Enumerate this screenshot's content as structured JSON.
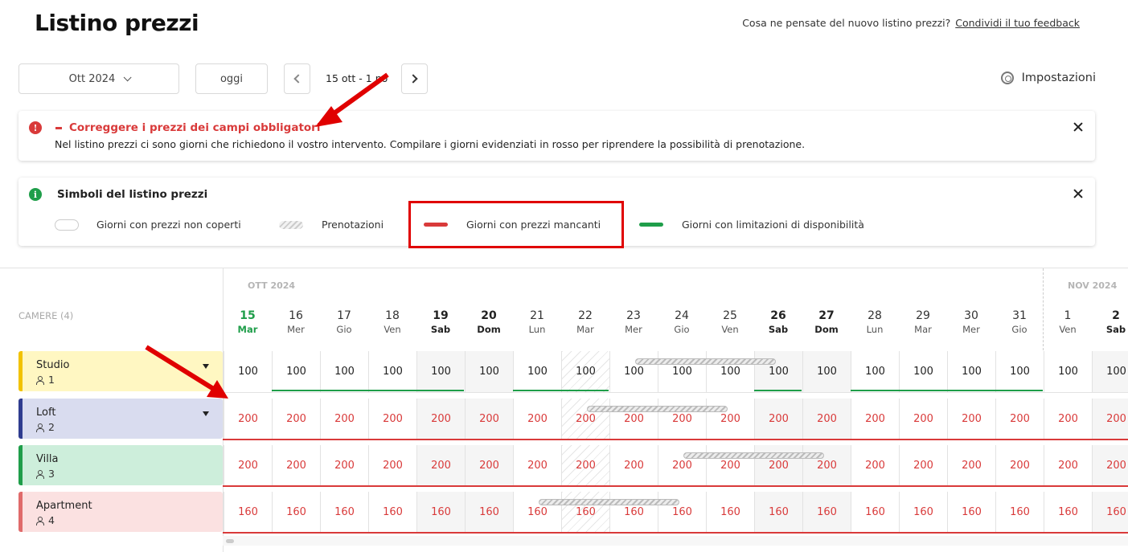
{
  "page": {
    "title": "Listino prezzi"
  },
  "feedback": {
    "question": "Cosa ne pensate del nuovo listino prezzi?",
    "link": "Condividi il tuo feedback"
  },
  "toolbar": {
    "month": "Ott 2024",
    "today": "oggi",
    "range": "15 ott - 1 no",
    "settings": "Impostazioni"
  },
  "alert": {
    "title": "Correggere i prezzi dei campi obbligatori",
    "text": "Nel listino prezzi ci sono giorni che richiedono il vostro intervento. Compilare i giorni evidenziati in rosso per riprendere la possibilità di prenotazione."
  },
  "legend": {
    "title": "Simboli del listino prezzi",
    "items": [
      "Giorni con prezzi non coperti",
      "Prenotazioni",
      "Giorni con prezzi mancanti",
      "Giorni con limitazioni di disponibilità"
    ]
  },
  "grid": {
    "rooms_header": "CAMERE (4)",
    "months": [
      "OTT 2024",
      "NOV 2024"
    ],
    "days": [
      {
        "num": "15",
        "dow": "Mar",
        "kind": "today"
      },
      {
        "num": "16",
        "dow": "Mer",
        "kind": ""
      },
      {
        "num": "17",
        "dow": "Gio",
        "kind": ""
      },
      {
        "num": "18",
        "dow": "Ven",
        "kind": ""
      },
      {
        "num": "19",
        "dow": "Sab",
        "kind": "weekend"
      },
      {
        "num": "20",
        "dow": "Dom",
        "kind": "weekend"
      },
      {
        "num": "21",
        "dow": "Lun",
        "kind": ""
      },
      {
        "num": "22",
        "dow": "Mar",
        "kind": "selected"
      },
      {
        "num": "23",
        "dow": "Mer",
        "kind": ""
      },
      {
        "num": "24",
        "dow": "Gio",
        "kind": ""
      },
      {
        "num": "25",
        "dow": "Ven",
        "kind": ""
      },
      {
        "num": "26",
        "dow": "Sab",
        "kind": "weekend"
      },
      {
        "num": "27",
        "dow": "Dom",
        "kind": "weekend"
      },
      {
        "num": "28",
        "dow": "Lun",
        "kind": ""
      },
      {
        "num": "29",
        "dow": "Mar",
        "kind": ""
      },
      {
        "num": "30",
        "dow": "Mer",
        "kind": ""
      },
      {
        "num": "31",
        "dow": "Gio",
        "kind": ""
      },
      {
        "num": "1",
        "dow": "Ven",
        "kind": ""
      },
      {
        "num": "2",
        "dow": "Sab",
        "kind": "weekend"
      }
    ],
    "rooms": [
      {
        "name": "Studio",
        "capacity": "1",
        "color": "#fff7c2",
        "bar": "#f2c200",
        "price": "100",
        "status": "ok",
        "has_caret": true
      },
      {
        "name": "Loft",
        "capacity": "2",
        "color": "#d9dcef",
        "bar": "#2f3c8f",
        "price": "200",
        "status": "missing",
        "has_caret": true
      },
      {
        "name": "Villa",
        "capacity": "3",
        "color": "#cdeedb",
        "bar": "#1f9e4a",
        "price": "200",
        "status": "missing",
        "has_caret": false
      },
      {
        "name": "Apartment",
        "capacity": "4",
        "color": "#fbe1e1",
        "bar": "#e06b6b",
        "price": "160",
        "status": "missing",
        "has_caret": false
      }
    ]
  },
  "colors": {
    "accent_red": "#d93a3a",
    "accent_green": "#1f9e4a"
  }
}
